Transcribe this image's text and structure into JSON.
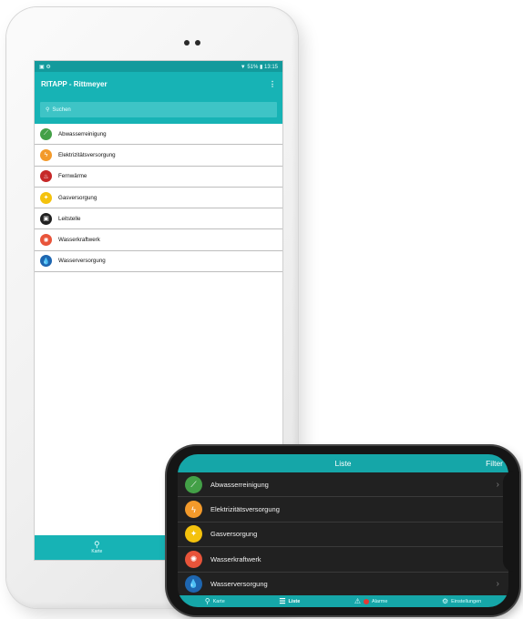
{
  "tablet": {
    "status_right": "▼ 51% ▮ 13:15",
    "status_left": "▣ ⚙",
    "app_title": "RITAPP - Rittmeyer",
    "menu_glyph": "⋮",
    "search_placeholder": "Suchen",
    "items": [
      {
        "label": "Abwasserreinigung",
        "icon": "pipe-icon",
        "glyph": "⟋",
        "color": "#43a047"
      },
      {
        "label": "Elektrizitätsversorgung",
        "icon": "lightning-icon",
        "glyph": "ϟ",
        "color": "#f39a2b"
      },
      {
        "label": "Fernwärme",
        "icon": "heat-icon",
        "glyph": "♨",
        "color": "#c62828"
      },
      {
        "label": "Gasversorgung",
        "icon": "flame-icon",
        "glyph": "✦",
        "color": "#f4c20d"
      },
      {
        "label": "Leitstelle",
        "icon": "monitor-icon",
        "glyph": "▣",
        "color": "#212121"
      },
      {
        "label": "Wasserkraftwerk",
        "icon": "turbine-icon",
        "glyph": "✺",
        "color": "#e8543a"
      },
      {
        "label": "Wasserversorgung",
        "icon": "droplet-icon",
        "glyph": "💧",
        "color": "#1e66b0"
      }
    ],
    "tabs": [
      {
        "label": "Karte",
        "icon": "map-icon",
        "glyph": "⚲"
      },
      {
        "label": "Liste",
        "icon": "list-icon",
        "glyph": "☰"
      }
    ]
  },
  "phone": {
    "title": "Liste",
    "filter": "Filter",
    "chevron": "›",
    "items": [
      {
        "label": "Abwasserreinigung",
        "icon": "pipe-icon",
        "glyph": "⟋",
        "color": "#43a047",
        "chevron": true
      },
      {
        "label": "Elektrizitätsversorgung",
        "icon": "lightning-icon",
        "glyph": "ϟ",
        "color": "#f39a2b",
        "chevron": false
      },
      {
        "label": "Gasversorgung",
        "icon": "flame-icon",
        "glyph": "✦",
        "color": "#f4c20d",
        "chevron": false
      },
      {
        "label": "Wasserkraftwerk",
        "icon": "turbine-icon",
        "glyph": "✺",
        "color": "#e8543a",
        "chevron": false
      },
      {
        "label": "Wasserversorgung",
        "icon": "droplet-icon",
        "glyph": "💧",
        "color": "#1e66b0",
        "chevron": true
      }
    ],
    "tabs": [
      {
        "label": "Karte",
        "icon": "map-icon",
        "glyph": "⚲",
        "active": false
      },
      {
        "label": "Liste",
        "icon": "list-icon",
        "glyph": "☰",
        "active": true
      },
      {
        "label": "Alarme",
        "icon": "alarm-icon",
        "glyph": "⚠",
        "active": false
      },
      {
        "label": "Einstellungen",
        "icon": "gear-icon",
        "glyph": "⚙",
        "active": false
      }
    ]
  },
  "colors": {
    "accent": "#17b3b5",
    "accent_dark": "#139a9c",
    "phone_background": "#212121"
  }
}
